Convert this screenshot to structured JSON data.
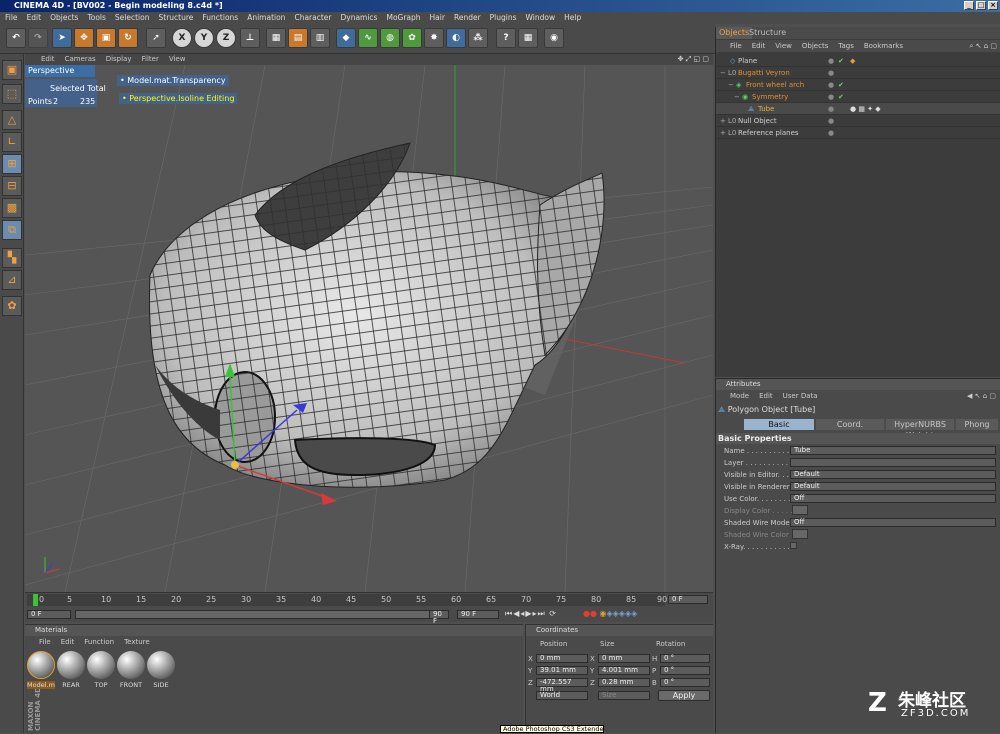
{
  "window": {
    "title": "CINEMA 4D - [BV002 - Begin modeling 8.c4d *]",
    "buttons": [
      "_",
      "□",
      "×"
    ]
  },
  "menubar": [
    "File",
    "Edit",
    "Objects",
    "Tools",
    "Selection",
    "Structure",
    "Functions",
    "Animation",
    "Character",
    "Dynamics",
    "MoGraph",
    "Hair",
    "Render",
    "Plugins",
    "Window",
    "Help"
  ],
  "toolbar": {
    "x": "X",
    "y": "Y",
    "z": "Z"
  },
  "viewport": {
    "menu": [
      "Edit",
      "Cameras",
      "Display",
      "Filter",
      "View"
    ],
    "name": "Perspective",
    "hud_selected": "Selected Total",
    "hud_points_label": "Points",
    "hud_points_selected": "2",
    "hud_points_total": "235",
    "hud_material": "Model.mat.Transparency",
    "hud_isoline": "Perspective.Isoline Editing"
  },
  "timeline": {
    "ticks": [
      "0",
      "5",
      "10",
      "15",
      "20",
      "25",
      "30",
      "35",
      "40",
      "45",
      "50",
      "55",
      "60",
      "65",
      "70",
      "75",
      "80",
      "85",
      "90"
    ],
    "current_frame": "0 F",
    "start": "0 F",
    "end": "90 F",
    "max": "90 F"
  },
  "materials": {
    "title": "Materials",
    "menu": [
      "File",
      "Edit",
      "Function",
      "Texture"
    ],
    "items": [
      "Model.m",
      "REAR",
      "TOP",
      "FRONT",
      "SIDE"
    ],
    "brand_line1": "MAXON",
    "brand_line2": "CINEMA 4D"
  },
  "coordinates": {
    "title": "Coordinates",
    "headers": [
      "Position",
      "Size",
      "Rotation"
    ],
    "rows": [
      {
        "pos_label": "X",
        "pos": "0 mm",
        "size_label": "X",
        "size": "0 mm",
        "rot_label": "H",
        "rot": "0 °"
      },
      {
        "pos_label": "Y",
        "pos": "39.01 mm",
        "size_label": "Y",
        "size": "4.001 mm",
        "rot_label": "P",
        "rot": "0 °"
      },
      {
        "pos_label": "Z",
        "pos": "-472.557 mm",
        "size_label": "Z",
        "size": "0.28 mm",
        "rot_label": "B",
        "rot": "0 °"
      }
    ],
    "space": "World",
    "size_mode": "Size",
    "apply": "Apply"
  },
  "objects": {
    "tabs": [
      "Objects",
      "Structure"
    ],
    "menu": [
      "File",
      "Edit",
      "View",
      "Objects",
      "Tags",
      "Bookmarks"
    ],
    "tree": [
      {
        "name": "Plane",
        "indent": 0,
        "color": "#cfcfcf"
      },
      {
        "name": "Bugatti Veyron",
        "indent": 0,
        "color": "#e09030"
      },
      {
        "name": "Front wheel arch",
        "indent": 1,
        "color": "#e09030"
      },
      {
        "name": "Symmetry",
        "indent": 2,
        "color": "#e09030"
      },
      {
        "name": "Tube",
        "indent": 3,
        "color": "#e8b030"
      },
      {
        "name": "Null Object",
        "indent": 0,
        "color": "#cfcfcf"
      },
      {
        "name": "Reference planes",
        "indent": 0,
        "color": "#cfcfcf"
      }
    ]
  },
  "attributes": {
    "title": "Attributes",
    "menu": [
      "Mode",
      "Edit",
      "User Data"
    ],
    "object": "Polygon Object [Tube]",
    "tabs": [
      "Basic",
      "Coord.",
      "HyperNURBS Weight",
      "Phong"
    ],
    "section": "Basic Properties",
    "props": [
      {
        "label": "Name . . . . . . . . . . . .",
        "value": "Tube",
        "kind": "text"
      },
      {
        "label": "Layer . . . . . . . . . . . .",
        "value": "",
        "kind": "text"
      },
      {
        "label": "Visible in Editor. . . . .",
        "value": "Default",
        "kind": "dropdown"
      },
      {
        "label": "Visible in Renderer . . .",
        "value": "Default",
        "kind": "dropdown"
      },
      {
        "label": "Use Color. . . . . . . . .",
        "value": "Off",
        "kind": "dropdown"
      },
      {
        "label": "Display Color . . . . . .",
        "value": "",
        "kind": "swatch"
      },
      {
        "label": "Shaded Wire Mode",
        "value": "Off",
        "kind": "dropdown"
      },
      {
        "label": "Shaded Wire Color",
        "value": "",
        "kind": "swatch"
      },
      {
        "label": "X-Ray. . . . . . . . . . .",
        "value": "",
        "kind": "check"
      }
    ]
  },
  "taskbar_tip": "Adobe Photoshop CS3 Extended",
  "watermark": {
    "cn": "朱峰社区",
    "url": "ZF3D.COM"
  }
}
